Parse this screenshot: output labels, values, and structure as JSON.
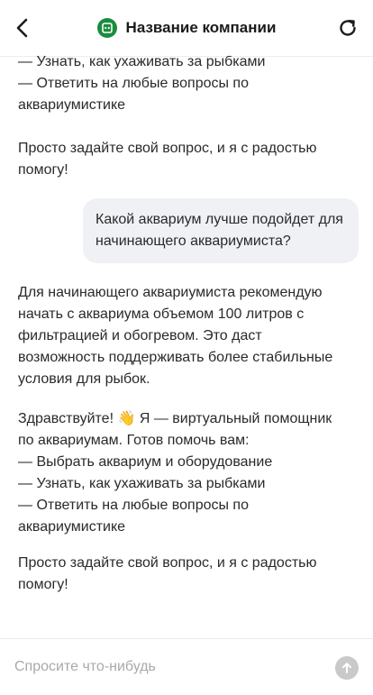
{
  "header": {
    "title": "Название компании",
    "back_icon": "chevron-left-icon",
    "refresh_icon": "refresh-icon",
    "logo_color": "#1a8d3d"
  },
  "messages": {
    "partial_intro_top": "— Узнать, как ухаживать за рыбками\n— Ответить на любые вопросы по\nаквариумистике",
    "prompt_top": "Просто задайте свой вопрос, и я с радостью\nпомогу!",
    "user_question": "Какой аквариум лучше подойдет для начинающего аквариумиста?",
    "bot_answer": "Для начинающего аквариумиста рекомендую\nначать с аквариума объемом 100 литров с\nфильтрацией и обогревом. Это даст\nвозможность поддерживать более стабильные\nусловия для рыбок.",
    "bot_greeting": "Здравствуйте! 👋 Я — виртуальный помощник\nпо аквариумам. Готов помочь вам:\n— Выбрать аквариум и оборудование\n— Узнать, как ухаживать за рыбками\n— Ответить на любые вопросы по\nаквариумистике",
    "prompt_bottom": "Просто задайте свой вопрос, и я с радостью\nпомогу!"
  },
  "composer": {
    "placeholder": "Спросите что-нибудь",
    "send_icon": "arrow-up-icon"
  }
}
